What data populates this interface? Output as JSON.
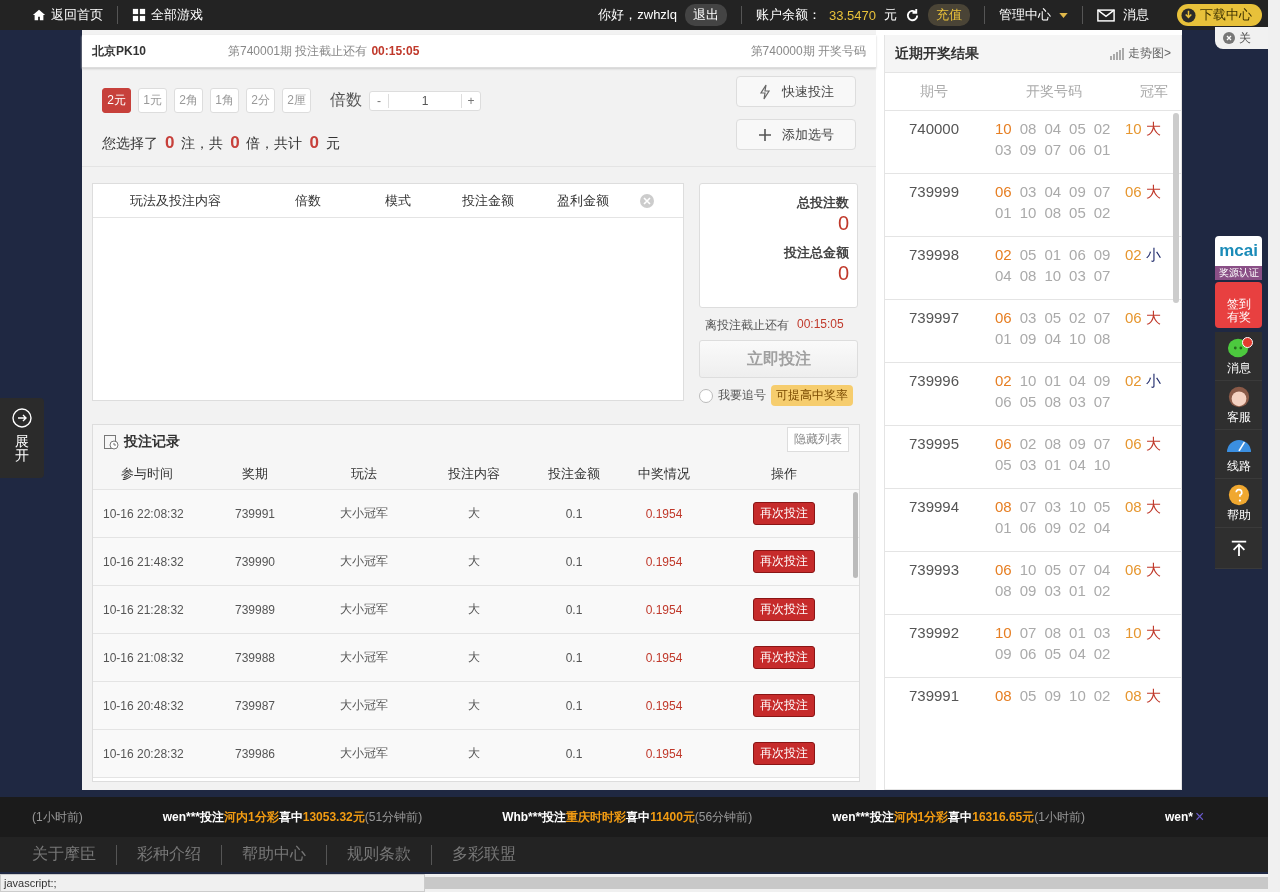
{
  "topbar": {
    "home": "返回首页",
    "all_games": "全部游戏",
    "greeting": "你好，zwhzlq",
    "logout": "退出",
    "balance_label": "账户余额：",
    "balance": "33.5470",
    "unit": "元",
    "recharge": "充值",
    "manage": "管理中心",
    "messages": "消息",
    "download": "下载中心"
  },
  "game": {
    "name": "北京PK10",
    "period_prefix": "第740001期 投注截止还有",
    "countdown": "00:15:05",
    "last_period": "第740000期 开奖号码"
  },
  "modes": [
    {
      "label": "2元",
      "selected": true
    },
    {
      "label": "1元",
      "selected": false
    },
    {
      "label": "2角",
      "selected": false
    },
    {
      "label": "1角",
      "selected": false
    },
    {
      "label": "2分",
      "selected": false
    },
    {
      "label": "2厘",
      "selected": false
    }
  ],
  "multiplier": {
    "label": "倍数",
    "minus": "-",
    "value": "1",
    "plus": "+"
  },
  "quick_bet": "快速投注",
  "add_number": "添加选号",
  "selection": {
    "t1": "您选择了",
    "bets": "0",
    "t2": "注，共",
    "times": "0",
    "t3": "倍，共计",
    "amount": "0",
    "t4": "元"
  },
  "bet_table": {
    "columns": [
      "玩法及投注内容",
      "倍数",
      "模式",
      "投注金额",
      "盈利金额"
    ]
  },
  "summary": {
    "count_label": "总投注数",
    "count": "0",
    "total_label": "投注总金额",
    "total": "0",
    "deadline_label": "离投注截止还有",
    "deadline": "00:15:05",
    "submit": "立即投注",
    "chase_label": "我要追号",
    "chase_checked": false,
    "chase_badge": "可提高中奖率"
  },
  "records": {
    "title": "投注记录",
    "hide": "隐藏列表",
    "columns": [
      "参与时间",
      "奖期",
      "玩法",
      "投注内容",
      "投注金额",
      "中奖情况",
      "操作"
    ],
    "rows": [
      {
        "time": "10-16 22:08:32",
        "period": "739991",
        "play": "大小冠军",
        "content": "大",
        "amount": "0.1",
        "win": "0.1954",
        "action": "再次投注"
      },
      {
        "time": "10-16 21:48:32",
        "period": "739990",
        "play": "大小冠军",
        "content": "大",
        "amount": "0.1",
        "win": "0.1954",
        "action": "再次投注"
      },
      {
        "time": "10-16 21:28:32",
        "period": "739989",
        "play": "大小冠军",
        "content": "大",
        "amount": "0.1",
        "win": "0.1954",
        "action": "再次投注"
      },
      {
        "time": "10-16 21:08:32",
        "period": "739988",
        "play": "大小冠军",
        "content": "大",
        "amount": "0.1",
        "win": "0.1954",
        "action": "再次投注"
      },
      {
        "time": "10-16 20:48:32",
        "period": "739987",
        "play": "大小冠军",
        "content": "大",
        "amount": "0.1",
        "win": "0.1954",
        "action": "再次投注"
      },
      {
        "time": "10-16 20:28:32",
        "period": "739986",
        "play": "大小冠军",
        "content": "大",
        "amount": "0.1",
        "win": "0.1954",
        "action": "再次投注"
      }
    ]
  },
  "results": {
    "title": "近期开奖结果",
    "trend": "走势图>",
    "columns": [
      "期号",
      "开奖号码",
      "冠军"
    ],
    "rows": [
      {
        "period": "740000",
        "numbers": [
          "10",
          "08",
          "04",
          "05",
          "02",
          "03",
          "09",
          "07",
          "06",
          "01"
        ],
        "champion": "10",
        "size": "大",
        "kind": "big"
      },
      {
        "period": "739999",
        "numbers": [
          "06",
          "03",
          "04",
          "09",
          "07",
          "01",
          "10",
          "08",
          "05",
          "02"
        ],
        "champion": "06",
        "size": "大",
        "kind": "big"
      },
      {
        "period": "739998",
        "numbers": [
          "02",
          "05",
          "01",
          "06",
          "09",
          "04",
          "08",
          "10",
          "03",
          "07"
        ],
        "champion": "02",
        "size": "小",
        "kind": "small"
      },
      {
        "period": "739997",
        "numbers": [
          "06",
          "03",
          "05",
          "02",
          "07",
          "01",
          "09",
          "04",
          "10",
          "08"
        ],
        "champion": "06",
        "size": "大",
        "kind": "big"
      },
      {
        "period": "739996",
        "numbers": [
          "02",
          "10",
          "01",
          "04",
          "09",
          "06",
          "05",
          "08",
          "03",
          "07"
        ],
        "champion": "02",
        "size": "小",
        "kind": "small"
      },
      {
        "period": "739995",
        "numbers": [
          "06",
          "02",
          "08",
          "09",
          "07",
          "05",
          "03",
          "01",
          "04",
          "10"
        ],
        "champion": "06",
        "size": "大",
        "kind": "big"
      },
      {
        "period": "739994",
        "numbers": [
          "08",
          "07",
          "03",
          "10",
          "05",
          "01",
          "06",
          "09",
          "02",
          "04"
        ],
        "champion": "08",
        "size": "大",
        "kind": "big"
      },
      {
        "period": "739993",
        "numbers": [
          "06",
          "10",
          "05",
          "07",
          "04",
          "08",
          "09",
          "03",
          "01",
          "02"
        ],
        "champion": "06",
        "size": "大",
        "kind": "big"
      },
      {
        "period": "739992",
        "numbers": [
          "10",
          "07",
          "08",
          "01",
          "03",
          "09",
          "06",
          "05",
          "04",
          "02"
        ],
        "champion": "10",
        "size": "大",
        "kind": "big"
      },
      {
        "period": "739991",
        "numbers": [
          "08",
          "05",
          "09",
          "10",
          "02"
        ],
        "champion": "08",
        "size": "大",
        "kind": "big"
      }
    ]
  },
  "side_tab": {
    "line1": "展",
    "line2": "开"
  },
  "close_ad": "关",
  "toolbar": {
    "logo": "mcai",
    "cert": "奖源认证",
    "sign": "签到有奖",
    "items": [
      {
        "label": "消息",
        "kind": "chat",
        "badge": true
      },
      {
        "label": "客服",
        "kind": "service",
        "badge": false
      },
      {
        "label": "线路",
        "kind": "route",
        "badge": false
      },
      {
        "label": "帮助",
        "kind": "help",
        "badge": false
      }
    ]
  },
  "ticker": [
    {
      "ago": "(1小时前)"
    },
    {
      "user": "wen***",
      "verb": "投注",
      "game": "河内1分彩",
      "mid": "喜中",
      "prize": "13053.32元",
      "ago": "(51分钟前)"
    },
    {
      "user": "Whb***",
      "verb": "投注",
      "game": "重庆时时彩",
      "mid": "喜中",
      "prize": "11400元",
      "ago": "(56分钟前)"
    },
    {
      "user": "wen***",
      "verb": "投注",
      "game": "河内1分彩",
      "mid": "喜中",
      "prize": "16316.65元",
      "ago": "(1小时前)"
    },
    {
      "user": "wen*"
    }
  ],
  "ticker_close": "×",
  "footer_links": [
    "关于摩臣",
    "彩种介绍",
    "帮助中心",
    "规则条款",
    "多彩联盟"
  ],
  "status_bar": "javascript:;"
}
